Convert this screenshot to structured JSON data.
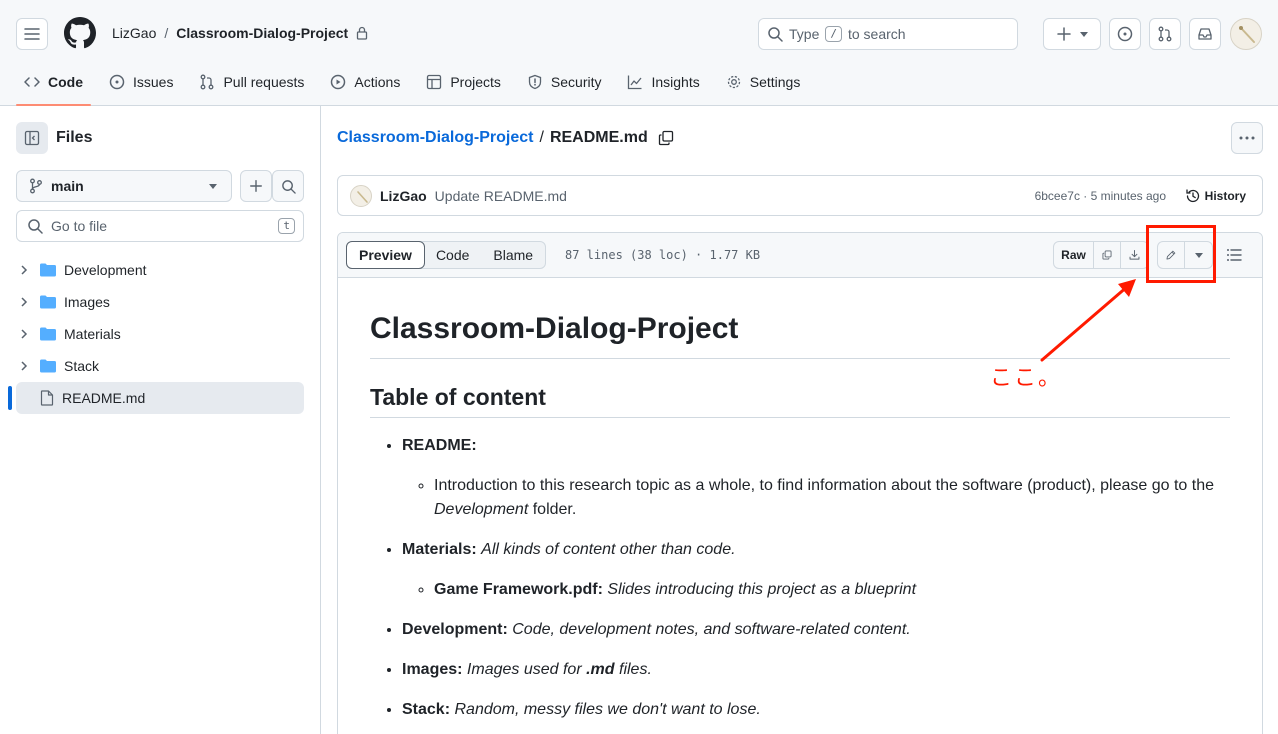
{
  "header": {
    "owner": "LizGao",
    "separator": "/",
    "repo": "Classroom-Dialog-Project",
    "search_prefix": "Type",
    "search_key": "/",
    "search_suffix": "to search"
  },
  "tabs": [
    {
      "label": "Code",
      "icon": "code-icon"
    },
    {
      "label": "Issues",
      "icon": "issue-icon"
    },
    {
      "label": "Pull requests",
      "icon": "pull-request-icon"
    },
    {
      "label": "Actions",
      "icon": "play-icon"
    },
    {
      "label": "Projects",
      "icon": "table-icon"
    },
    {
      "label": "Security",
      "icon": "shield-icon"
    },
    {
      "label": "Insights",
      "icon": "graph-icon"
    },
    {
      "label": "Settings",
      "icon": "gear-icon"
    }
  ],
  "sidebar": {
    "title": "Files",
    "branch": "main",
    "goto_placeholder": "Go to file",
    "goto_key": "t",
    "items": [
      {
        "label": "Development",
        "type": "folder"
      },
      {
        "label": "Images",
        "type": "folder"
      },
      {
        "label": "Materials",
        "type": "folder"
      },
      {
        "label": "Stack",
        "type": "folder"
      },
      {
        "label": "README.md",
        "type": "file"
      }
    ]
  },
  "file": {
    "repo_link": "Classroom-Dialog-Project",
    "separator": "/",
    "name": "README.md"
  },
  "commit": {
    "author": "LizGao",
    "message": "Update README.md",
    "meta": "6bcee7c · 5 minutes ago",
    "history_label": "History"
  },
  "viewer": {
    "tabs": [
      "Preview",
      "Code",
      "Blame"
    ],
    "info": "87 lines (38 loc) · 1.77 KB",
    "raw_label": "Raw"
  },
  "readme": {
    "h1": "Classroom-Dialog-Project",
    "h2": "Table of content",
    "items": [
      {
        "bold": "README:",
        "sub": {
          "text1": "Introduction to this research topic as a whole, to find information about the software (product), please go to the ",
          "em": "Development",
          "text2": " folder."
        }
      },
      {
        "bold": "Materials:",
        "italic": "All kinds of content other than code.",
        "sub": {
          "bold": "Game Framework.pdf:",
          "italic": "Slides introducing this project as a blueprint"
        }
      },
      {
        "bold": "Development:",
        "italic": "Code, development notes, and software-related content."
      },
      {
        "bold": "Images:",
        "italic_a": "Images used for ",
        "bold_italic": ".md",
        "italic_b": " files."
      },
      {
        "bold": "Stack:",
        "italic": "Random, messy files we don't want to lose."
      }
    ]
  },
  "annotation": {
    "text": "ここ。",
    "color": "#ff1a00"
  }
}
